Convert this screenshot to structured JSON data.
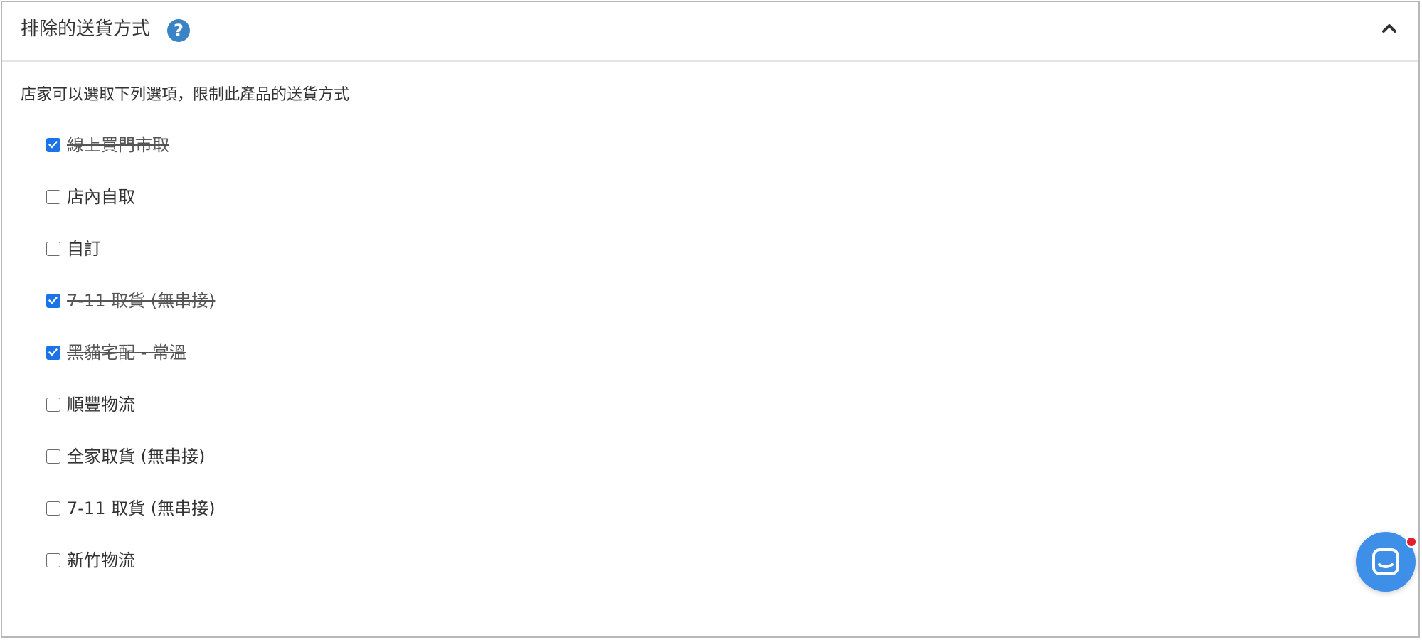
{
  "header": {
    "title": "排除的送貨方式",
    "help_icon": "question-circle-icon",
    "collapse_icon": "chevron-up-icon"
  },
  "description": "店家可以選取下列選項，限制此產品的送貨方式",
  "options": [
    {
      "label": "線上買門市取",
      "checked": true
    },
    {
      "label": "店內自取",
      "checked": false
    },
    {
      "label": "自訂",
      "checked": false
    },
    {
      "label": "7-11 取貨 (無串接)",
      "checked": true
    },
    {
      "label": "黑貓宅配 - 常溫",
      "checked": true
    },
    {
      "label": "順豐物流",
      "checked": false
    },
    {
      "label": "全家取貨 (無串接)",
      "checked": false
    },
    {
      "label": "7-11 取貨 (無串接)",
      "checked": false
    },
    {
      "label": "新竹物流",
      "checked": false
    }
  ],
  "chat_launcher": {
    "icon": "chat-bubble-icon",
    "has_notification": true
  },
  "colors": {
    "accent": "#1a73e8",
    "help": "#3a84c6",
    "chat": "#3d8fe8",
    "notification": "#e0202a"
  }
}
